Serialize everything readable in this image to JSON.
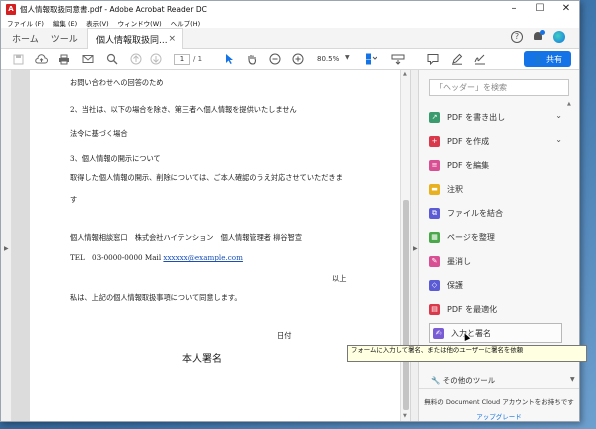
{
  "window": {
    "title": "個人情報取扱同意書.pdf - Adobe Acrobat Reader DC",
    "app_icon_label": "A",
    "controls": {
      "minimize": "–",
      "maximize": "☐",
      "close": "✕"
    }
  },
  "menubar": {
    "items": [
      "ファイル (F)",
      "編集 (E)",
      "表示(V)",
      "ウィンドウ(W)",
      "ヘルプ(H)"
    ]
  },
  "tabs": {
    "home": "ホーム",
    "tools": "ツール",
    "document": "個人情報取扱同...",
    "close": "×"
  },
  "toolbar": {
    "page_current": "1",
    "page_total": "/ 1",
    "zoom": "80.5%",
    "zoom_arrow": "▼",
    "share_label": "共有",
    "share_icon": "👤"
  },
  "document": {
    "lines": [
      "お問い合わせへの回答のため",
      "2、当社は、以下の場合を除き、第三者へ個人情報を提供いたしません",
      "法令に基づく場合",
      "3、個人情報の開示について",
      "取得した個人情報の開示、削除については、ご本人確認のうえ対応させていただきま",
      "す",
      "個人情報相談窓口　株式会社ハイテンション　個人情報管理者 柳谷智宣"
    ],
    "contact_prefix": "TEL　03-0000-0000 Mail ",
    "contact_email": "xxxxxx@example.com",
    "ijou": "以上",
    "agree": "私は、上記の個人情報取扱事項について同意します。",
    "date_label": "日付",
    "signature_label": "本人署名"
  },
  "panel": {
    "search_placeholder": "「ヘッダー」を検索",
    "tools": [
      {
        "label": "PDF を書き出し",
        "icon": "export-pdf-icon",
        "color": "#3a9c6e",
        "chevron": "⌄"
      },
      {
        "label": "PDF を作成",
        "icon": "create-pdf-icon",
        "color": "#d9394a",
        "chevron": "⌄"
      },
      {
        "label": "PDF を編集",
        "icon": "edit-pdf-icon",
        "color": "#d94f94"
      },
      {
        "label": "注釈",
        "icon": "comment-icon",
        "color": "#e8b11f"
      },
      {
        "label": "ファイルを結合",
        "icon": "combine-files-icon",
        "color": "#5b5bd6"
      },
      {
        "label": "ページを整理",
        "icon": "organize-pages-icon",
        "color": "#4aa84a"
      },
      {
        "label": "墨消し",
        "icon": "redact-icon",
        "color": "#d94f94"
      },
      {
        "label": "保護",
        "icon": "protect-icon",
        "color": "#5b5bd6"
      },
      {
        "label": "PDF を最適化",
        "icon": "optimize-pdf-icon",
        "color": "#d9394a"
      },
      {
        "label": "入力と署名",
        "icon": "fill-sign-icon",
        "color": "#7a5bd6"
      }
    ],
    "tooltip": "フォームに入力して署名、または他のユーザーに署名を依頼",
    "other_tools": "その他のツール",
    "footer_text": "無料の Document Cloud アカウントをお持ちです",
    "footer_link": "アップグレード"
  },
  "colors": {
    "accent": "#1473e6",
    "pdf_red": "#d42020",
    "link": "#1a4fb4"
  }
}
